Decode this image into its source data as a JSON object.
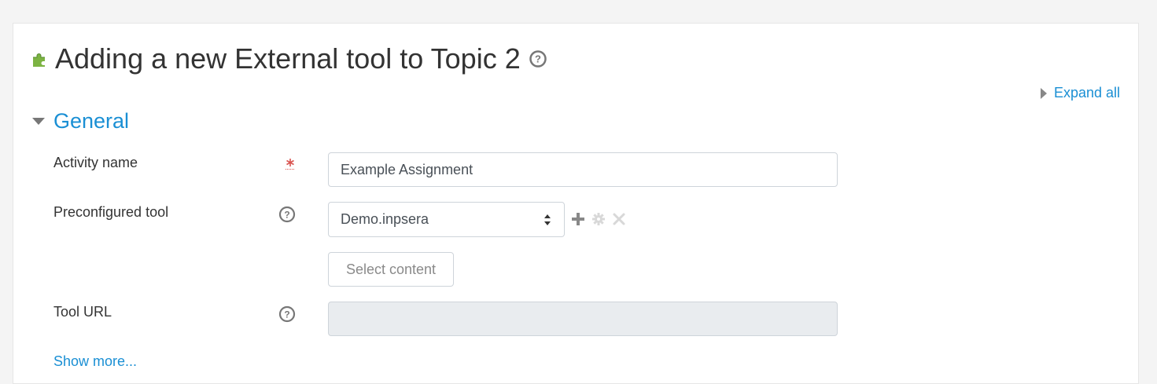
{
  "page": {
    "title": "Adding a new External tool to Topic 2"
  },
  "header": {
    "expand_all_label": "Expand all"
  },
  "section": {
    "title": "General"
  },
  "fields": {
    "activity_name": {
      "label": "Activity name",
      "value": "Example Assignment"
    },
    "preconfigured_tool": {
      "label": "Preconfigured tool",
      "selected": "Demo.inpsera"
    },
    "select_content_label": "Select content",
    "tool_url": {
      "label": "Tool URL",
      "value": ""
    }
  },
  "show_more_label": "Show more...",
  "icons": {
    "module": "puzzle-icon",
    "help": "question-circle-icon",
    "required": "required-asterisk-icon",
    "add": "plus-icon",
    "configure": "gear-icon",
    "delete": "close-icon"
  },
  "colors": {
    "link": "#1a8fd4",
    "required": "#d9534f",
    "module_icon": "#7cb342",
    "disabled_bg": "#e9ecef"
  }
}
